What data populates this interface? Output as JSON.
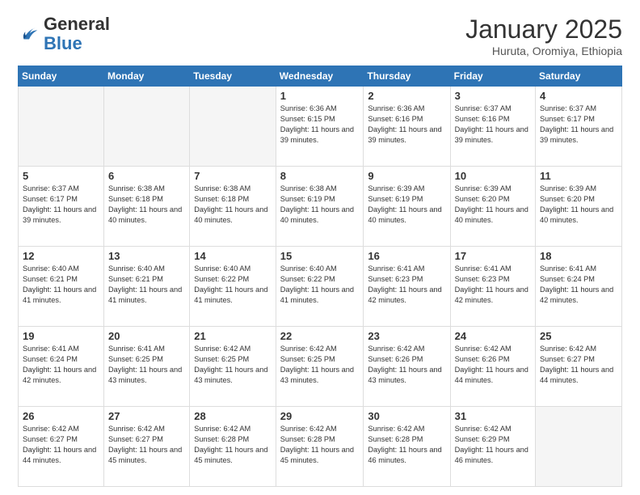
{
  "header": {
    "logo_general": "General",
    "logo_blue": "Blue",
    "month_title": "January 2025",
    "subtitle": "Huruta, Oromiya, Ethiopia"
  },
  "days_of_week": [
    "Sunday",
    "Monday",
    "Tuesday",
    "Wednesday",
    "Thursday",
    "Friday",
    "Saturday"
  ],
  "weeks": [
    [
      {
        "day": "",
        "info": ""
      },
      {
        "day": "",
        "info": ""
      },
      {
        "day": "",
        "info": ""
      },
      {
        "day": "1",
        "info": "Sunrise: 6:36 AM\nSunset: 6:15 PM\nDaylight: 11 hours and 39 minutes."
      },
      {
        "day": "2",
        "info": "Sunrise: 6:36 AM\nSunset: 6:16 PM\nDaylight: 11 hours and 39 minutes."
      },
      {
        "day": "3",
        "info": "Sunrise: 6:37 AM\nSunset: 6:16 PM\nDaylight: 11 hours and 39 minutes."
      },
      {
        "day": "4",
        "info": "Sunrise: 6:37 AM\nSunset: 6:17 PM\nDaylight: 11 hours and 39 minutes."
      }
    ],
    [
      {
        "day": "5",
        "info": "Sunrise: 6:37 AM\nSunset: 6:17 PM\nDaylight: 11 hours and 39 minutes."
      },
      {
        "day": "6",
        "info": "Sunrise: 6:38 AM\nSunset: 6:18 PM\nDaylight: 11 hours and 40 minutes."
      },
      {
        "day": "7",
        "info": "Sunrise: 6:38 AM\nSunset: 6:18 PM\nDaylight: 11 hours and 40 minutes."
      },
      {
        "day": "8",
        "info": "Sunrise: 6:38 AM\nSunset: 6:19 PM\nDaylight: 11 hours and 40 minutes."
      },
      {
        "day": "9",
        "info": "Sunrise: 6:39 AM\nSunset: 6:19 PM\nDaylight: 11 hours and 40 minutes."
      },
      {
        "day": "10",
        "info": "Sunrise: 6:39 AM\nSunset: 6:20 PM\nDaylight: 11 hours and 40 minutes."
      },
      {
        "day": "11",
        "info": "Sunrise: 6:39 AM\nSunset: 6:20 PM\nDaylight: 11 hours and 40 minutes."
      }
    ],
    [
      {
        "day": "12",
        "info": "Sunrise: 6:40 AM\nSunset: 6:21 PM\nDaylight: 11 hours and 41 minutes."
      },
      {
        "day": "13",
        "info": "Sunrise: 6:40 AM\nSunset: 6:21 PM\nDaylight: 11 hours and 41 minutes."
      },
      {
        "day": "14",
        "info": "Sunrise: 6:40 AM\nSunset: 6:22 PM\nDaylight: 11 hours and 41 minutes."
      },
      {
        "day": "15",
        "info": "Sunrise: 6:40 AM\nSunset: 6:22 PM\nDaylight: 11 hours and 41 minutes."
      },
      {
        "day": "16",
        "info": "Sunrise: 6:41 AM\nSunset: 6:23 PM\nDaylight: 11 hours and 42 minutes."
      },
      {
        "day": "17",
        "info": "Sunrise: 6:41 AM\nSunset: 6:23 PM\nDaylight: 11 hours and 42 minutes."
      },
      {
        "day": "18",
        "info": "Sunrise: 6:41 AM\nSunset: 6:24 PM\nDaylight: 11 hours and 42 minutes."
      }
    ],
    [
      {
        "day": "19",
        "info": "Sunrise: 6:41 AM\nSunset: 6:24 PM\nDaylight: 11 hours and 42 minutes."
      },
      {
        "day": "20",
        "info": "Sunrise: 6:41 AM\nSunset: 6:25 PM\nDaylight: 11 hours and 43 minutes."
      },
      {
        "day": "21",
        "info": "Sunrise: 6:42 AM\nSunset: 6:25 PM\nDaylight: 11 hours and 43 minutes."
      },
      {
        "day": "22",
        "info": "Sunrise: 6:42 AM\nSunset: 6:25 PM\nDaylight: 11 hours and 43 minutes."
      },
      {
        "day": "23",
        "info": "Sunrise: 6:42 AM\nSunset: 6:26 PM\nDaylight: 11 hours and 43 minutes."
      },
      {
        "day": "24",
        "info": "Sunrise: 6:42 AM\nSunset: 6:26 PM\nDaylight: 11 hours and 44 minutes."
      },
      {
        "day": "25",
        "info": "Sunrise: 6:42 AM\nSunset: 6:27 PM\nDaylight: 11 hours and 44 minutes."
      }
    ],
    [
      {
        "day": "26",
        "info": "Sunrise: 6:42 AM\nSunset: 6:27 PM\nDaylight: 11 hours and 44 minutes."
      },
      {
        "day": "27",
        "info": "Sunrise: 6:42 AM\nSunset: 6:27 PM\nDaylight: 11 hours and 45 minutes."
      },
      {
        "day": "28",
        "info": "Sunrise: 6:42 AM\nSunset: 6:28 PM\nDaylight: 11 hours and 45 minutes."
      },
      {
        "day": "29",
        "info": "Sunrise: 6:42 AM\nSunset: 6:28 PM\nDaylight: 11 hours and 45 minutes."
      },
      {
        "day": "30",
        "info": "Sunrise: 6:42 AM\nSunset: 6:28 PM\nDaylight: 11 hours and 46 minutes."
      },
      {
        "day": "31",
        "info": "Sunrise: 6:42 AM\nSunset: 6:29 PM\nDaylight: 11 hours and 46 minutes."
      },
      {
        "day": "",
        "info": ""
      }
    ]
  ]
}
